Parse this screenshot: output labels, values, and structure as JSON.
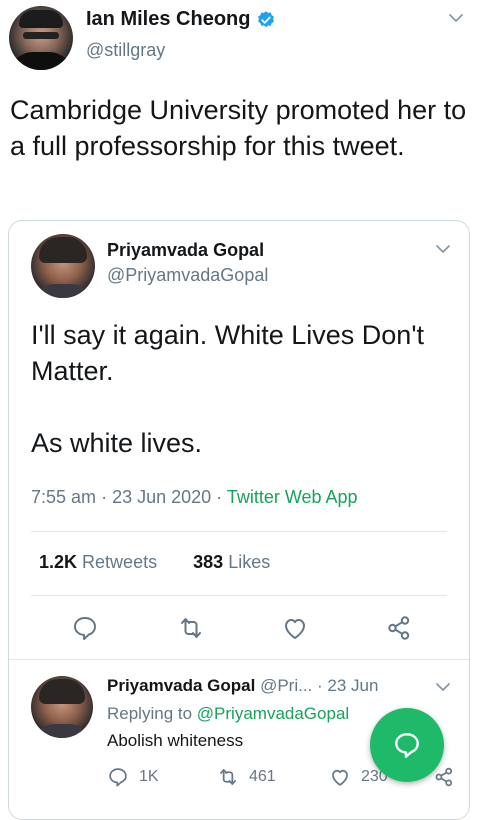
{
  "outer": {
    "name": "Ian Miles Cheong",
    "handle": "@stillgray",
    "text": "Cambridge University promoted her to a full professorship for this tweet."
  },
  "quoted": {
    "name": "Priyamvada Gopal",
    "handle": "@PriyamvadaGopal",
    "text": "I'll say it again. White Lives Don't Matter.\n\nAs white lives.",
    "time": "7:55 am",
    "date": "23 Jun 2020",
    "source": "Twitter Web App",
    "retweets_count": "1.2K",
    "retweets_label": "Retweets",
    "likes_count": "383",
    "likes_label": "Likes"
  },
  "reply": {
    "name": "Priyamvada Gopal",
    "handle": "@Pri...",
    "date": "23 Jun",
    "replying_label": "Replying to",
    "replying_handle": "@PriyamvadaGopal",
    "text": "Abolish whiteness",
    "reply_count": "1K",
    "retweet_count": "461",
    "like_count": "230"
  },
  "icons": {
    "verified": "verified-badge-icon",
    "chevron": "chevron-down-icon",
    "reply": "reply-icon",
    "retweet": "retweet-icon",
    "like": "heart-icon",
    "share": "share-icon",
    "compose": "compose-reply-icon"
  },
  "colors": {
    "accent_green": "#17a35b",
    "fab_green": "#1fb96a",
    "verified_blue": "#1da1f2",
    "muted": "#657786"
  }
}
